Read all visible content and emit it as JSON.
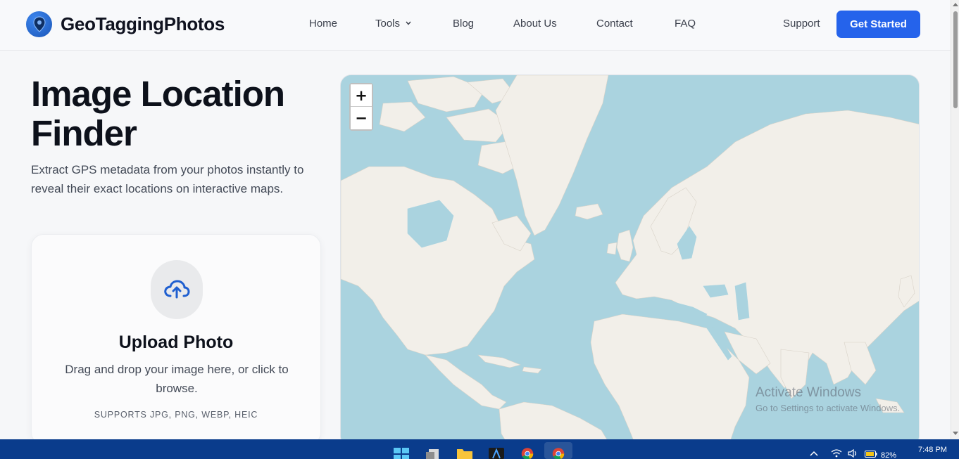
{
  "header": {
    "brand_name": "GeoTaggingPhotos",
    "nav": {
      "home": "Home",
      "tools": "Tools",
      "blog": "Blog",
      "about": "About Us",
      "contact": "Contact",
      "faq": "FAQ"
    },
    "support": "Support",
    "cta": "Get Started"
  },
  "hero": {
    "title_line1": "Image Location",
    "title_line2": "Finder",
    "subtitle": "Extract GPS metadata from your photos instantly to reveal their exact locations on interactive maps."
  },
  "upload": {
    "title": "Upload Photo",
    "description": "Drag and drop your image here, or click to browse.",
    "formats": "SUPPORTS JPG, PNG, WEBP, HEIC"
  },
  "map": {
    "zoom_in": "+",
    "zoom_out": "−"
  },
  "watermark": {
    "line1": "Activate Windows",
    "line2": "Go to Settings to activate Windows."
  },
  "taskbar": {
    "battery": "82%",
    "time": "7:48 PM"
  },
  "colors": {
    "accent": "#2563eb",
    "ocean": "#aad3df",
    "land": "#f2efe9",
    "taskbar": "#0a3c8c"
  }
}
